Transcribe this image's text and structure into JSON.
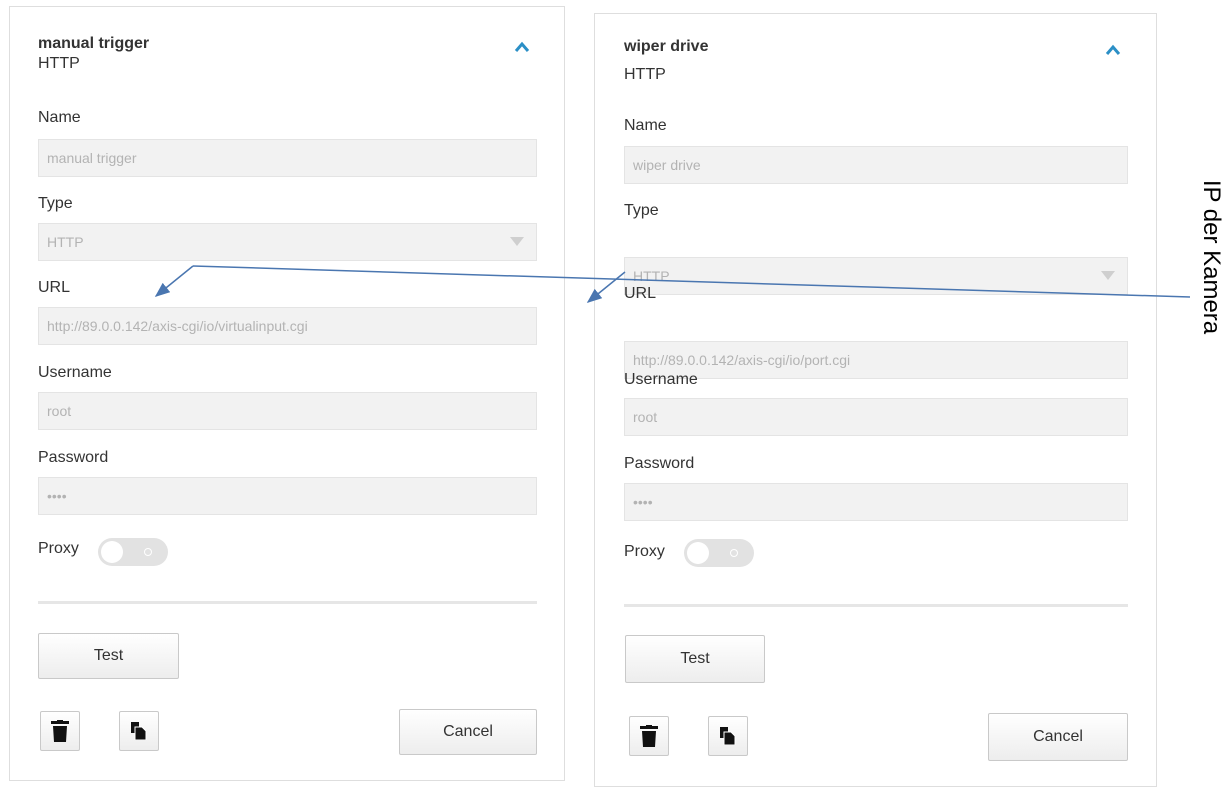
{
  "panels": [
    {
      "title": "manual trigger",
      "subtitle": "HTTP",
      "labels": {
        "name": "Name",
        "type": "Type",
        "url": "URL",
        "username": "Username",
        "password": "Password",
        "proxy": "Proxy"
      },
      "fields": {
        "name": "manual trigger",
        "type": "HTTP",
        "url": "http://89.0.0.142/axis-cgi/io/virtualinput.cgi",
        "username": "root",
        "password": "••••"
      },
      "proxy_enabled": false,
      "test_label": "Test",
      "cancel_label": "Cancel"
    },
    {
      "title": "wiper drive",
      "subtitle": "HTTP",
      "labels": {
        "name": "Name",
        "type": "Type",
        "url": "URL",
        "username": "Username",
        "password": "Password",
        "proxy": "Proxy"
      },
      "fields": {
        "name": "wiper drive",
        "type": "HTTP",
        "url": "http://89.0.0.142/axis-cgi/io/port.cgi",
        "username": "root",
        "password": "••••"
      },
      "proxy_enabled": false,
      "test_label": "Test",
      "cancel_label": "Cancel"
    }
  ],
  "annotation": {
    "label": "IP der Kamera",
    "color": "#4a76b0"
  },
  "colors": {
    "accent": "#2b8fc6",
    "field_background": "#f2f2f2",
    "field_text": "#b3b3b3",
    "toggle_off": "#e2e2e2"
  },
  "icons": {
    "collapse": "chevron-up-icon",
    "select": "caret-down-icon",
    "delete": "trash-icon",
    "duplicate": "copy-icon"
  }
}
